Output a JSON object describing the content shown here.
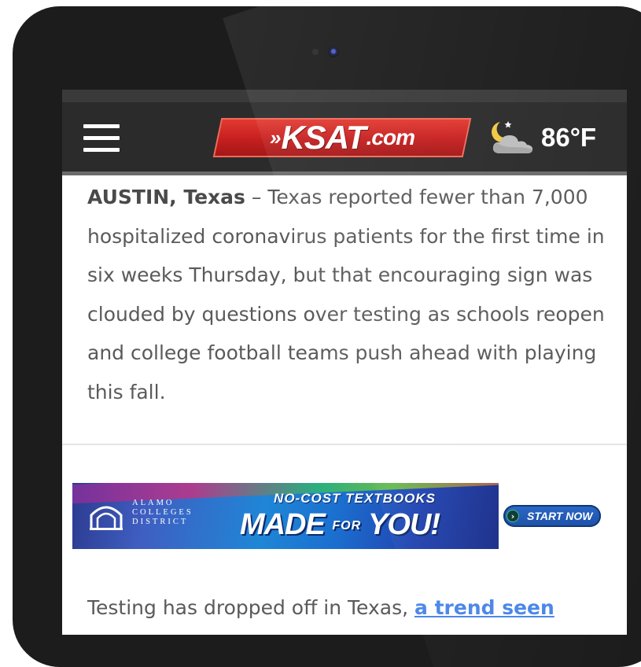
{
  "header": {
    "logo": {
      "arrows": "»",
      "main": "KSAT",
      "suffix": ".com"
    },
    "weather": {
      "icon": "moon-cloud-icon",
      "temperature": "86°F"
    },
    "menu_icon": "hamburger-menu-icon"
  },
  "article": {
    "dateline": "AUSTIN, Texas",
    "separator": " – ",
    "body": "Texas reported fewer than 7,000 hospitalized coronavirus patients for the first time in six weeks Thursday, but that encouraging sign was clouded by questions over testing as schools reopen and college football teams push ahead with playing this fall."
  },
  "ad": {
    "org_line1": "ALAMO",
    "org_line2": "COLLEGES",
    "org_line3": "DISTRICT",
    "headline": "NO-COST TEXTBOOKS",
    "tagline_made": "MADE",
    "tagline_for": "FOR",
    "tagline_you": "YOU!",
    "cta": "START NOW",
    "cta_icon": "chevron-right-icon",
    "emblem_icon": "arch-emblem-icon"
  },
  "article2": {
    "text_before": "Testing has dropped off in Texas, ",
    "link_text": "a trend seen"
  },
  "colors": {
    "nav_bg": "#2b2b2b",
    "logo_red": "#c51f1f",
    "body_text": "#5a5a5a",
    "link": "#4a86e8"
  }
}
